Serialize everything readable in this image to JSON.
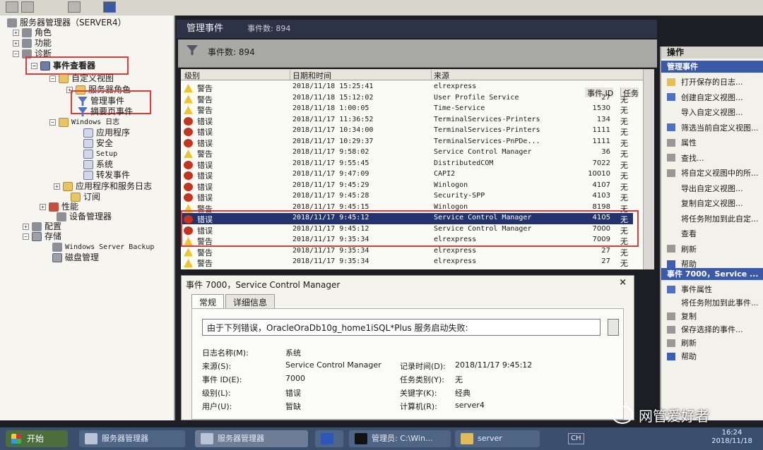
{
  "tree": {
    "root": "服务器管理器（SERVER4）",
    "roles": "角色",
    "features": "功能",
    "diagnostics": "诊断",
    "event_viewer": "事件查看器",
    "custom_views": "自定义视图",
    "server_roles": "服务器角色",
    "admin_events": "管理事件",
    "summary_events": "摘要页事件",
    "windows_logs": "Windows 日志",
    "application": "应用程序",
    "security": "安全",
    "setup": "Setup",
    "system": "系统",
    "forwarded": "转发事件",
    "apps_services": "应用程序和服务日志",
    "subscriptions": "订阅",
    "performance": "性能",
    "device_manager": "设备管理器",
    "config": "配置",
    "storage": "存储",
    "wsb": "Windows Server Backup",
    "disk_mgmt": "磁盘管理"
  },
  "center": {
    "title": "管理事件",
    "count_label": "事件数: 894",
    "filter_text": "事件数: 894"
  },
  "grid": {
    "col_level": "级别",
    "col_datetime": "日期和时间",
    "col_source": "来源",
    "col_eventid": "事件 ID",
    "col_task": "任务",
    "rows": [
      {
        "level": "警告",
        "type": "warn",
        "dt": "2018/11/18 15:25:41",
        "src": "elrexpress",
        "eid": "",
        "task": ""
      },
      {
        "level": "警告",
        "type": "warn",
        "dt": "2018/11/18 15:12:02",
        "src": "User Profile Service",
        "eid": "27",
        "task": "无"
      },
      {
        "level": "警告",
        "type": "warn",
        "dt": "2018/11/18 1:00:05",
        "src": "Time-Service",
        "eid": "1530",
        "task": "无"
      },
      {
        "level": "错误",
        "type": "err",
        "dt": "2018/11/17 11:36:52",
        "src": "TerminalServices-Printers",
        "eid": "134",
        "task": "无"
      },
      {
        "level": "错误",
        "type": "err",
        "dt": "2018/11/17 10:34:00",
        "src": "TerminalServices-Printers",
        "eid": "1111",
        "task": "无"
      },
      {
        "level": "错误",
        "type": "err",
        "dt": "2018/11/17 10:29:37",
        "src": "TerminalServices-PnPDe...",
        "eid": "1111",
        "task": "无"
      },
      {
        "level": "警告",
        "type": "warn",
        "dt": "2018/11/17 9:58:02",
        "src": "Service Control Manager",
        "eid": "36",
        "task": "无"
      },
      {
        "level": "错误",
        "type": "err",
        "dt": "2018/11/17 9:55:45",
        "src": "DistributedCOM",
        "eid": "7022",
        "task": "无"
      },
      {
        "level": "错误",
        "type": "err",
        "dt": "2018/11/17 9:47:09",
        "src": "CAPI2",
        "eid": "10010",
        "task": "无"
      },
      {
        "level": "错误",
        "type": "err",
        "dt": "2018/11/17 9:45:29",
        "src": "Winlogon",
        "eid": "4107",
        "task": "无"
      },
      {
        "level": "错误",
        "type": "err",
        "dt": "2018/11/17 9:45:28",
        "src": "Security-SPP",
        "eid": "4103",
        "task": "无"
      },
      {
        "level": "警告",
        "type": "warn",
        "dt": "2018/11/17 9:45:15",
        "src": "Winlogon",
        "eid": "8198",
        "task": "无"
      },
      {
        "level": "错误",
        "type": "err",
        "dt": "2018/11/17 9:45:12",
        "src": "Service Control Manager",
        "eid": "4105",
        "task": "无"
      },
      {
        "level": "错误",
        "type": "err",
        "dt": "2018/11/17 9:45:12",
        "src": "Service Control Manager",
        "eid": "7000",
        "task": "无"
      },
      {
        "level": "警告",
        "type": "warn",
        "dt": "2018/11/17 9:35:34",
        "src": "elrexpress",
        "eid": "7009",
        "task": "无"
      },
      {
        "level": "警告",
        "type": "warn",
        "dt": "2018/11/17 9:35:34",
        "src": "elrexpress",
        "eid": "27",
        "task": "无"
      },
      {
        "level": "警告",
        "type": "warn",
        "dt": "2018/11/17 9:35:34",
        "src": "elrexpress",
        "eid": "27",
        "task": "无"
      }
    ]
  },
  "detail": {
    "title": "事件 7000，Service Control Manager",
    "close": "×",
    "tab_general": "常规",
    "tab_details": "详细信息",
    "message": "由于下列错误，OracleOraDb10g_home1iSQL*Plus 服务启动失败:",
    "log_name_label": "日志名称(M):",
    "log_name": "系统",
    "source_label": "来源(S):",
    "source": "Service Control Manager",
    "logged_label": "记录时间(D):",
    "logged": "2018/11/17 9:45:12",
    "eventid_label": "事件 ID(E):",
    "eventid": "7000",
    "category_label": "任务类别(Y):",
    "category": "无",
    "level_label": "级别(L):",
    "level": "错误",
    "keywords_label": "关键字(K):",
    "keywords": "经典",
    "user_label": "用户(U):",
    "user": "暂缺",
    "computer_label": "计算机(R):",
    "computer": "server4"
  },
  "actions": {
    "header": "操作",
    "section1": "管理事件",
    "items1": [
      "打开保存的日志...",
      "创建自定义视图...",
      "导入自定义视图...",
      "筛选当前自定义视图...",
      "属性",
      "查找...",
      "将自定义视图中的所...",
      "导出自定义视图...",
      "复制自定义视图...",
      "将任务附加到此自定...",
      "查看",
      "刷新",
      "帮助"
    ],
    "section2": "事件 7000，Service ...",
    "items2": [
      "事件属性",
      "将任务附加到此事件...",
      "复制",
      "保存选择的事件...",
      "刷新",
      "帮助"
    ]
  },
  "taskbar": {
    "start": "开始",
    "btn1": "服务器管理器",
    "btn2": "服务器管理器",
    "btn3": "管理员: C:\\Win...",
    "btn4": "server",
    "ime": "CH",
    "time": "16:24",
    "date": "2018/11/18"
  },
  "watermark": "网管爱好者"
}
